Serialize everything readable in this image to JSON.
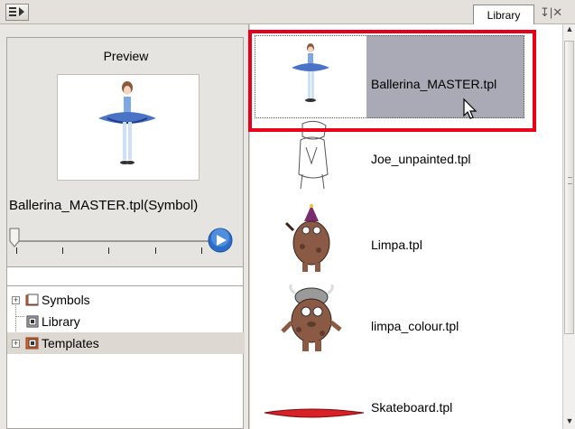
{
  "toolbar": {
    "menu_icon": "panel-menu-icon",
    "tab_label": "Library",
    "tab_controls": "↧|✕"
  },
  "preview": {
    "title": "Preview",
    "name": "Ballerina_MASTER.tpl(Symbol)",
    "playback_progress": 0
  },
  "search": {
    "value": ""
  },
  "tree": {
    "items": [
      {
        "label": "Symbols",
        "expander": "+",
        "icon": "folder-icon"
      },
      {
        "label": "Library",
        "expander": "",
        "icon": "library-icon"
      },
      {
        "label": "Templates",
        "expander": "+",
        "icon": "templates-icon"
      }
    ]
  },
  "library": {
    "items": [
      {
        "label": "Ballerina_MASTER.tpl",
        "selected": true
      },
      {
        "label": "Joe_unpainted.tpl",
        "selected": false
      },
      {
        "label": "Limpa.tpl",
        "selected": false
      },
      {
        "label": "limpa_colour.tpl",
        "selected": false
      },
      {
        "label": "Skateboard.tpl",
        "selected": false
      }
    ]
  },
  "colors": {
    "selection": "#a9aab6",
    "highlight": "#e8001a",
    "play": "#2a6fc9"
  }
}
